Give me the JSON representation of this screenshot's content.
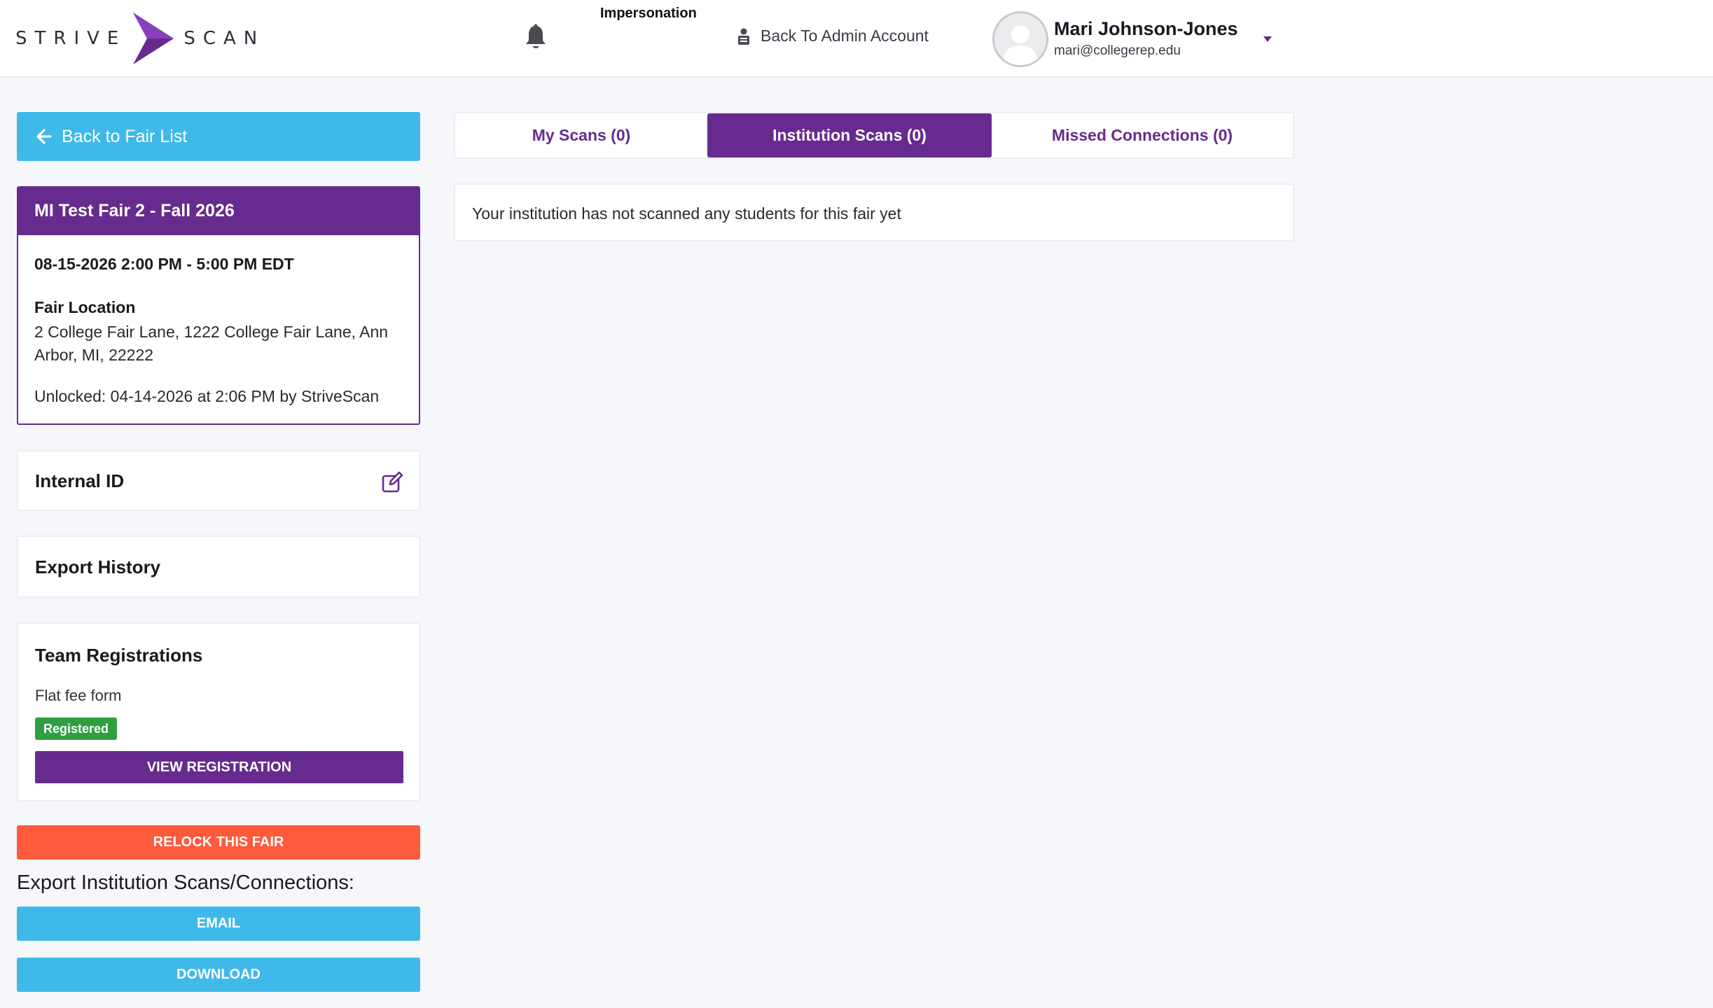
{
  "header": {
    "logo_left": "STRIVE",
    "logo_right": "SCAN",
    "impersonation_label": "Impersonation",
    "back_to_admin": "Back To Admin Account",
    "user_name": "Mari Johnson-Jones",
    "user_email": "mari@collegerep.edu",
    "icons": [
      "bell-icon",
      "user-lock-icon",
      "avatar",
      "caret-down-icon"
    ]
  },
  "sidebar": {
    "back_label": "Back to Fair List",
    "fair": {
      "title": "MI Test Fair 2 - Fall 2026",
      "datetime": "08-15-2026 2:00 PM - 5:00 PM EDT",
      "location_label": "Fair Location",
      "location": "2 College Fair Lane, 1222 College Fair Lane, Ann Arbor, MI, 22222",
      "unlocked": "Unlocked: 04-14-2026 at 2:06 PM by StriveScan"
    },
    "internal_id_label": "Internal ID",
    "export_history_label": "Export History",
    "team_registrations": {
      "title": "Team Registrations",
      "form_name": "Flat fee form",
      "status_badge": "Registered",
      "view_button": "VIEW REGISTRATION"
    },
    "relock_button": "RELOCK THIS FAIR",
    "export_heading": "Export Institution Scans/Connections:",
    "email_button": "EMAIL",
    "download_button": "DOWNLOAD"
  },
  "main": {
    "tabs": [
      {
        "label": "My Scans (0)",
        "active": false
      },
      {
        "label": "Institution Scans (0)",
        "active": true
      },
      {
        "label": "Missed Connections (0)",
        "active": false
      }
    ],
    "empty_message": "Your institution has not scanned any students for this fair yet"
  },
  "colors": {
    "brand_purple": "#672b8f",
    "accent_blue": "#3fb9ea",
    "danger_orange": "#ff5a3c",
    "success_green": "#2e9e3f",
    "background": "#f6f7fa"
  }
}
